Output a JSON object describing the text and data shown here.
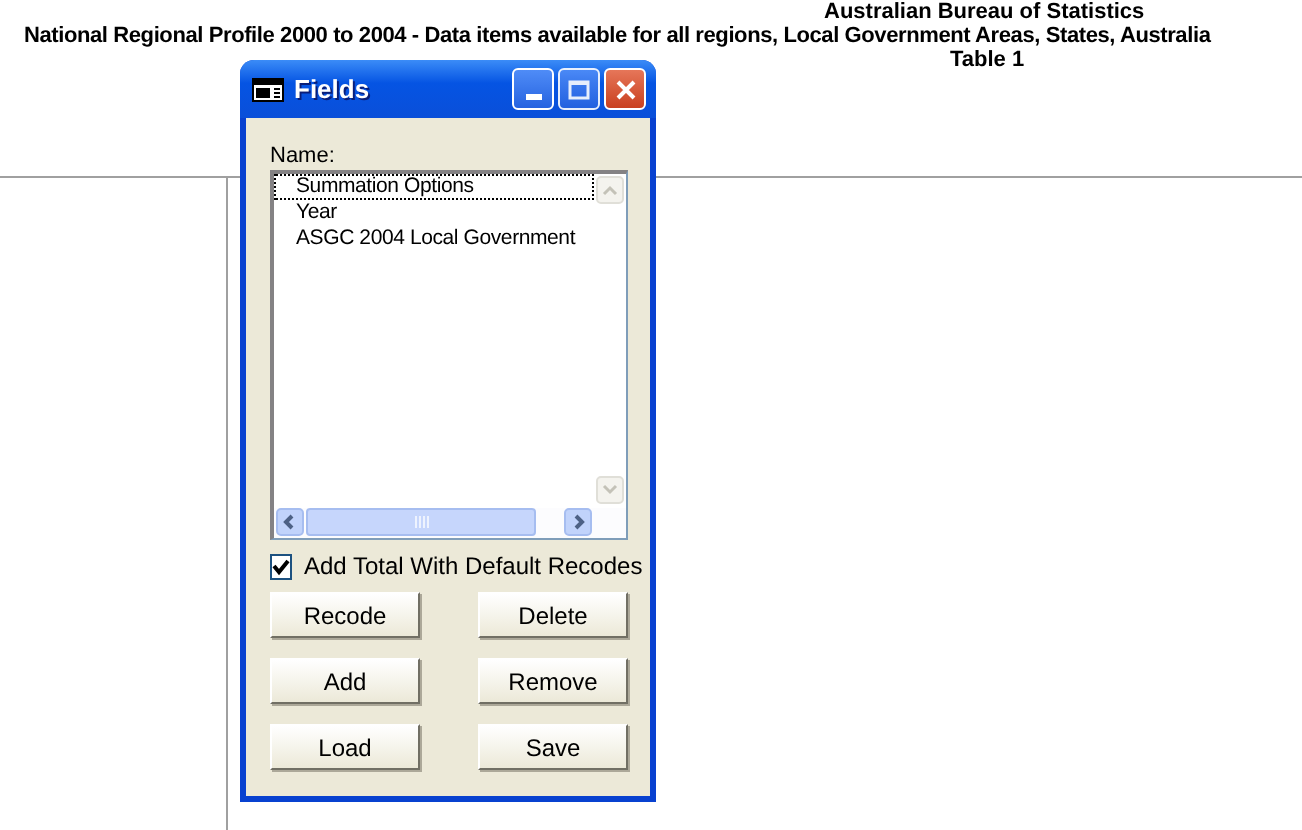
{
  "header": {
    "lines": [
      "Australian Bureau of Statistics",
      "National Regional Profile 2000 to 2004 - Data items available for all regions, Local Government Areas, States, Australia",
      "Table 1"
    ]
  },
  "dialog": {
    "title": "Fields",
    "list_label": "Name:",
    "items": [
      {
        "label": "Summation Options",
        "selected": true
      },
      {
        "label": "Year",
        "selected": false
      },
      {
        "label": "ASGC 2004 Local Government",
        "selected": false
      }
    ],
    "checkbox": {
      "label": "Add Total With Default Recodes",
      "checked": true
    },
    "buttons": [
      "Recode",
      "Delete",
      "Add",
      "Remove",
      "Load",
      "Save"
    ]
  }
}
